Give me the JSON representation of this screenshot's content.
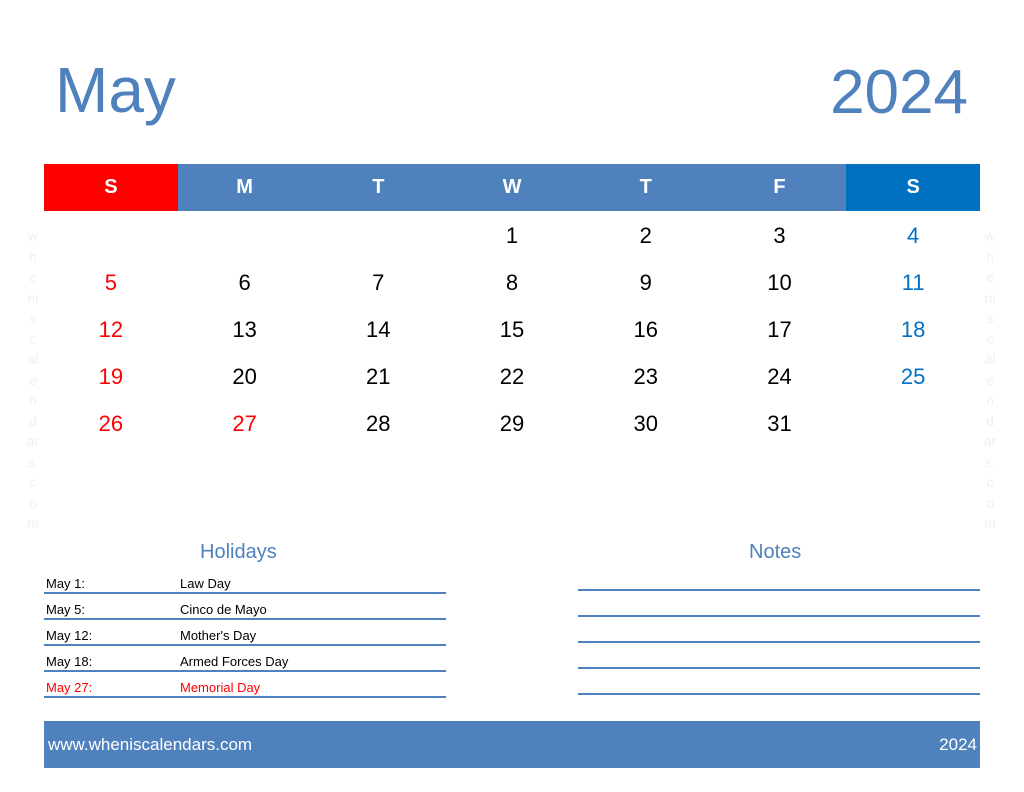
{
  "title": {
    "month": "May",
    "year": "2024"
  },
  "weekdays": [
    {
      "label": "S",
      "kind": "sun"
    },
    {
      "label": "M",
      "kind": ""
    },
    {
      "label": "T",
      "kind": ""
    },
    {
      "label": "W",
      "kind": ""
    },
    {
      "label": "T",
      "kind": ""
    },
    {
      "label": "F",
      "kind": ""
    },
    {
      "label": "S",
      "kind": "sat"
    }
  ],
  "weeks": [
    [
      "",
      "",
      "",
      "1",
      "2",
      "3",
      "4"
    ],
    [
      "5",
      "6",
      "7",
      "8",
      "9",
      "10",
      "11"
    ],
    [
      "12",
      "13",
      "14",
      "15",
      "16",
      "17",
      "18"
    ],
    [
      "19",
      "20",
      "21",
      "22",
      "23",
      "24",
      "25"
    ],
    [
      "26",
      "27",
      "28",
      "29",
      "30",
      "31",
      ""
    ]
  ],
  "highlighted_days": [
    "27"
  ],
  "watermark": [
    "w",
    "h",
    "e",
    "ni",
    "s",
    "c",
    "al",
    "e",
    "n",
    "d",
    "ar",
    "s.",
    "c",
    "o",
    "m"
  ],
  "holidays": {
    "title": "Holidays",
    "items": [
      {
        "date": "May 1:",
        "name": "Law Day",
        "red": false
      },
      {
        "date": "May 5:",
        "name": "Cinco de Mayo",
        "red": false
      },
      {
        "date": "May 12:",
        "name": "Mother's Day",
        "red": false
      },
      {
        "date": "May 18:",
        "name": "Armed Forces Day",
        "red": false
      },
      {
        "date": "May 27:",
        "name": "Memorial Day",
        "red": true
      }
    ]
  },
  "notes": {
    "title": "Notes",
    "line_count": 5
  },
  "footer": {
    "website": "www.wheniscalendars.com",
    "year": "2024"
  }
}
